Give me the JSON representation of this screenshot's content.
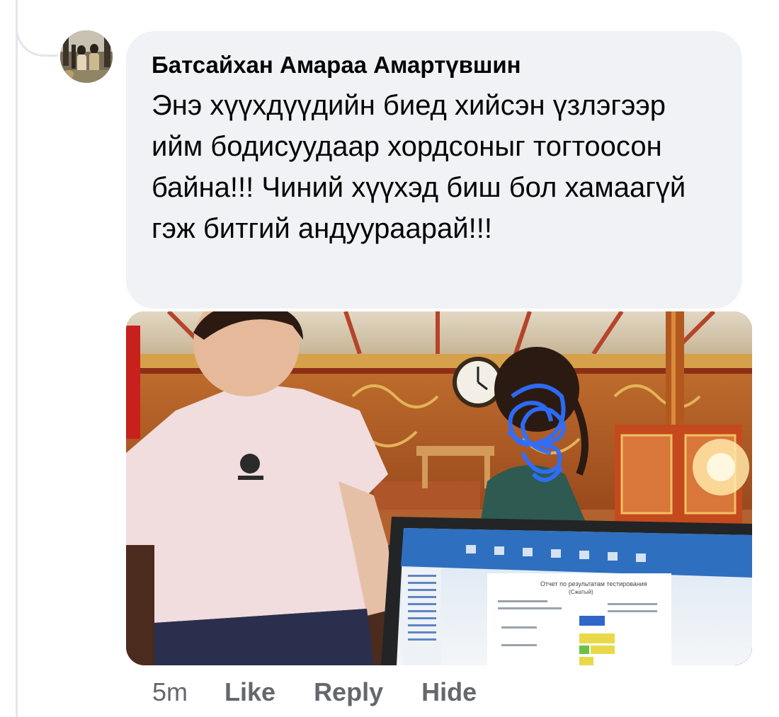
{
  "comment": {
    "author": "Батсайхан Амараа Амартүвшин",
    "text": "Энэ хүүхдүүдийн биед хийсэн үзлэгээр ийм бодисуудаар хордсоныг тогтоосон байна!!! Чиний хүүхэд биш бол хамаагүй гэж битгий андуураарай!!!",
    "avatar_icon": "profile-photo",
    "attachment": {
      "icon": "photo-attachment",
      "laptop_screen_lines": [
        "Отчет по результатам тестирования",
        "(Сжатый)"
      ]
    }
  },
  "actions": {
    "time": "5m",
    "like": "Like",
    "reply": "Reply",
    "hide": "Hide"
  },
  "colors": {
    "bubble": "#f0f2f5",
    "text": "#050505",
    "secondary": "#65676b"
  }
}
